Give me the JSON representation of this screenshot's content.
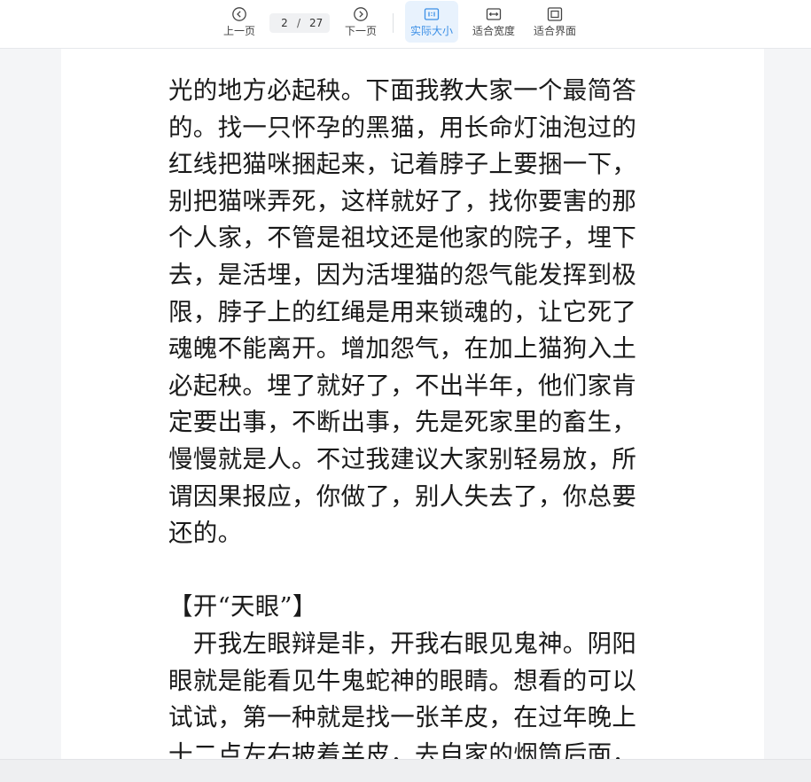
{
  "toolbar": {
    "prev_label": "上一页",
    "next_label": "下一页",
    "current_page": "2",
    "page_separator": "/",
    "total_pages": "27",
    "actual_size_label": "实际大小",
    "fit_width_label": "适合宽度",
    "fit_page_label": "适合界面",
    "accent_color": "#3b8fe6"
  },
  "document": {
    "lines": [
      "光的地方必起秧。下面我教大家一个最简答",
      "的。找一只怀孕的黑猫，用长命灯油泡过的",
      "红线把猫咪捆起来，记着脖子上要捆一下，",
      "别把猫咪弄死，这样就好了，找你要害的那",
      "个人家，不管是祖坟还是他家的院子，埋下",
      "去，是活埋，因为活埋猫的怨气能发挥到极",
      "限，脖子上的红绳是用来锁魂的，让它死了",
      "魂魄不能离开。增加怨气，在加上猫狗入土",
      "必起秧。埋了就好了，不出半年，他们家肯",
      "定要出事，不断出事，先是死家里的畜生，",
      "慢慢就是人。不过我建议大家别轻易放，所",
      "谓因果报应，你做了，别人失去了，你总要",
      "还的。"
    ],
    "section_heading": "【开“天眼”】",
    "lines2": [
      "　开我左眼辩是非，开我右眼见鬼神。阴阳",
      "眼就是能看见牛鬼蛇神的眼睛。想看的可以",
      "试试，第一种就是找一张羊皮，在过年晚上",
      "十二点左右披着羊皮，去自家的烟筒后面，"
    ]
  }
}
